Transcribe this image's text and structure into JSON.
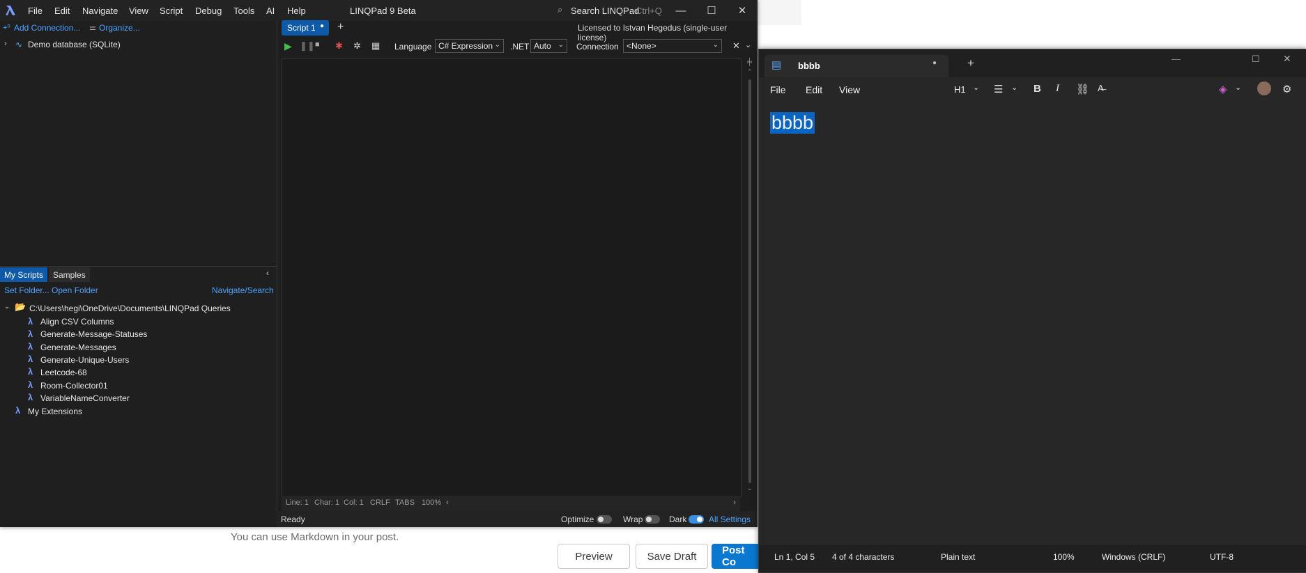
{
  "background_page": {
    "markdown_hint": "You can use Markdown in your post.",
    "buttons": {
      "preview": "Preview",
      "save_draft": "Save Draft",
      "post": "Post Co"
    }
  },
  "linqpad": {
    "title": "LINQPad 9 Beta",
    "menu": [
      "File",
      "Edit",
      "Navigate",
      "View",
      "Script",
      "Debug",
      "Tools",
      "AI",
      "Help"
    ],
    "search": {
      "label": "Search LINQPad",
      "shortcut": "Ctrl+Q"
    },
    "license": "Licensed to Istvan Hegedus (single-user license)",
    "connections": {
      "add": "Add Connection...",
      "organize": "Organize...",
      "database": "Demo database (SQLite)"
    },
    "script_tab": "Script 1",
    "toolbar": {
      "language_label": "Language",
      "language_value": "C# Expression",
      "net_label": ".NET",
      "net_value": "Auto",
      "connection_label": "Connection",
      "connection_value": "<None>"
    },
    "lower_tabs": {
      "my_scripts": "My Scripts",
      "samples": "Samples"
    },
    "folder_links": {
      "set_folder": "Set Folder...",
      "open_folder": "Open Folder",
      "navigate": "Navigate/Search"
    },
    "queries_folder": "C:\\Users\\hegi\\OneDrive\\Documents\\LINQPad Queries",
    "queries": [
      "Align CSV Columns",
      "Generate-Message-Statuses",
      "Generate-Messages",
      "Generate-Unique-Users",
      "Leetcode-68",
      "Room-Collector01",
      "VariableNameConverter"
    ],
    "extensions": "My Extensions",
    "editor_status": {
      "line": "Line: 1",
      "char": "Char: 1",
      "col": "Col: 1",
      "eol": "CRLF",
      "indent": "TABS",
      "zoom": "100%"
    },
    "bottom": {
      "status": "Ready",
      "optimize": "Optimize",
      "wrap": "Wrap",
      "dark": "Dark",
      "settings": "All Settings"
    },
    "toggles": {
      "optimize": false,
      "wrap": false,
      "dark": true
    }
  },
  "notepad": {
    "tab_title": "bbbb",
    "menu": [
      "File",
      "Edit",
      "View"
    ],
    "heading_format": "H1",
    "content": "bbbb",
    "status": {
      "position": "Ln 1, Col 5",
      "count": "4 of 4 characters",
      "format": "Plain text",
      "zoom": "100%",
      "eol": "Windows (CRLF)",
      "encoding": "UTF-8"
    }
  },
  "colors": {
    "accent": "#3b8fe0",
    "link": "#4ea3ff",
    "selection": "#0a64c2",
    "post_button": "#0a78d1"
  }
}
